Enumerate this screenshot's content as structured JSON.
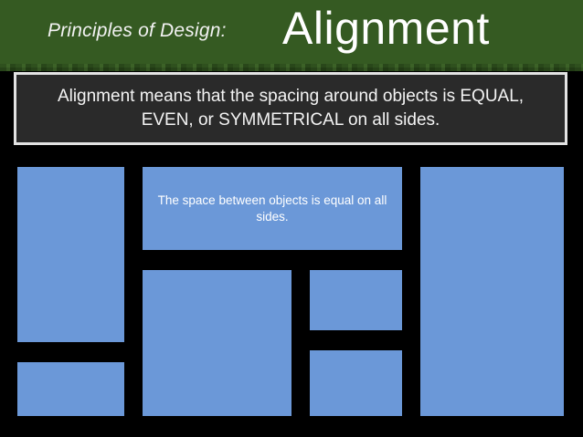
{
  "header": {
    "subtitle": "Principles of Design:",
    "title": "Alignment"
  },
  "banner": {
    "text": "Alignment means that the spacing around objects is EQUAL, EVEN, or SYMMETRICAL on all sides."
  },
  "diagram": {
    "caption": "The space between objects is equal on all sides."
  },
  "colors": {
    "header_green": "#355a22",
    "block_blue": "#6b98d8",
    "banner_bg": "#2a2a2a",
    "background": "#000000"
  }
}
